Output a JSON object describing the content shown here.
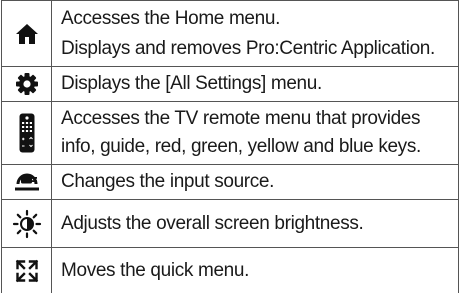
{
  "rows": [
    {
      "icon": "home-icon",
      "lines": [
        "Accesses the Home menu.",
        "Displays and removes Pro:Centric Application."
      ]
    },
    {
      "icon": "gear-icon",
      "lines": [
        "Displays the [All Settings] menu."
      ]
    },
    {
      "icon": "remote-control-icon",
      "lines": [
        "Accesses the TV remote menu that provides",
        "info, guide, red, green, yellow and blue keys."
      ]
    },
    {
      "icon": "input-source-icon",
      "lines": [
        "Changes the input source."
      ]
    },
    {
      "icon": "brightness-icon",
      "lines": [
        "Adjusts the overall screen brightness."
      ]
    },
    {
      "icon": "move-arrows-icon",
      "lines": [
        "Moves the quick menu."
      ]
    }
  ]
}
